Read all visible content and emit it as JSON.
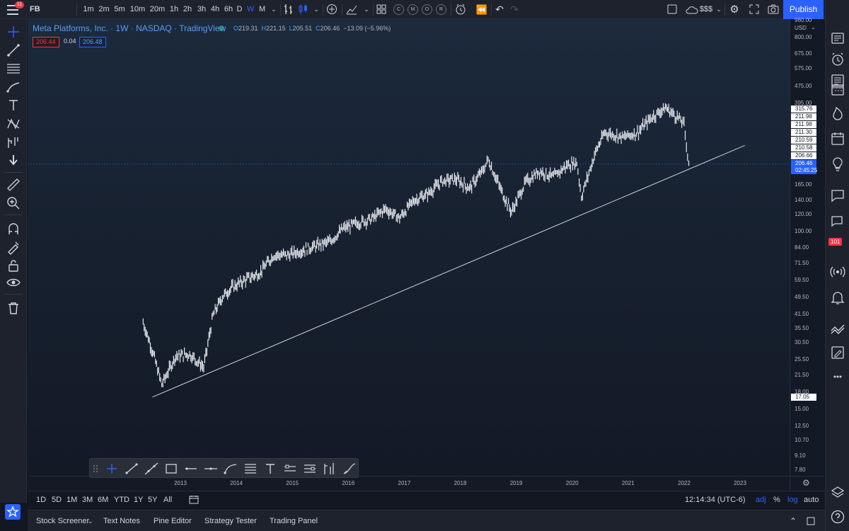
{
  "topbar": {
    "symbol": "FB",
    "notification_count": "11",
    "intervals": [
      "1m",
      "2m",
      "5m",
      "10m",
      "20m",
      "1h",
      "2h",
      "3h",
      "4h",
      "6h",
      "D",
      "W",
      "M"
    ],
    "active_interval": "W",
    "compare_label": "$$$",
    "publish_label": "Publish",
    "multi_chart_circles": [
      "C",
      "M",
      "O",
      "R"
    ]
  },
  "legend": {
    "title": "Meta Platforms, Inc.",
    "interval": "1W",
    "exchange": "NASDAQ",
    "source": "TradingView",
    "open_label": "O",
    "open": "219.31",
    "high_label": "H",
    "high": "221.15",
    "low_label": "L",
    "low": "205.51",
    "close_label": "C",
    "close": "206.46",
    "change": "−13.09 (−5.96%)",
    "bid": "206.44",
    "spread": "0.04",
    "ask": "206.48"
  },
  "price_scale": {
    "currency": "USD",
    "labels": [
      "960.00",
      "800.00",
      "675.00",
      "575.00",
      "475.00",
      "395.00",
      "165.00",
      "140.00",
      "120.00",
      "100.00",
      "84.00",
      "71.50",
      "59.50",
      "49.50",
      "41.50",
      "35.50",
      "30.50",
      "25.50",
      "21.50",
      "18.00",
      "15.00",
      "12.50",
      "10.70",
      "9.10",
      "7.80"
    ],
    "markers": [
      "315.76",
      "211.98",
      "211.98",
      "211.30",
      "210.59",
      "210.58",
      "206.66"
    ],
    "last_price": "206.46",
    "countdown": "02:45:25",
    "trendline_start_price": "17.05"
  },
  "time_scale": {
    "labels": [
      "2013",
      "2014",
      "2015",
      "2016",
      "2017",
      "2018",
      "2019",
      "2020",
      "2021",
      "2022",
      "2023"
    ]
  },
  "range_bar": {
    "ranges": [
      "1D",
      "5D",
      "1M",
      "3M",
      "6M",
      "YTD",
      "1Y",
      "5Y",
      "All"
    ],
    "clock": "12:14:34 (UTC-6)",
    "adj": "adj",
    "percent": "%",
    "log": "log",
    "auto": "auto"
  },
  "bottom_panel": {
    "tabs": [
      "Stock Screener",
      "Text Notes",
      "Pine Editor",
      "Strategy Tester",
      "Trading Panel"
    ]
  },
  "right_sidebar": {
    "alerts_badge": "101"
  },
  "chart_data": {
    "type": "line",
    "scale": "log",
    "series": [
      {
        "x": [
          "2012-05",
          "2012-07",
          "2012-09",
          "2012-12",
          "2013-03",
          "2013-06",
          "2013-08",
          "2013-10",
          "2013-12",
          "2014-03",
          "2014-06",
          "2014-09",
          "2014-12",
          "2015-03",
          "2015-06",
          "2015-09",
          "2015-12",
          "2016-03",
          "2016-06",
          "2016-09",
          "2016-12",
          "2017-03",
          "2017-06",
          "2017-09",
          "2017-12",
          "2018-03",
          "2018-06",
          "2018-07",
          "2018-10",
          "2018-12",
          "2019-03",
          "2019-06",
          "2019-09",
          "2019-12",
          "2020-02",
          "2020-03",
          "2020-06",
          "2020-08",
          "2020-12",
          "2021-03",
          "2021-06",
          "2021-09",
          "2021-12",
          "2022-01",
          "2022-02"
        ],
        "y": [
          38.0,
          28.0,
          19.5,
          26.5,
          27.0,
          23.5,
          41.0,
          50.0,
          55.0,
          60.0,
          64.5,
          78.0,
          78.0,
          82.0,
          86.0,
          90.0,
          104.0,
          110.0,
          115.0,
          128.0,
          116.0,
          140.0,
          150.0,
          172.0,
          176.0,
          160.0,
          195.0,
          217.0,
          152.0,
          124.0,
          170.0,
          192.0,
          180.0,
          205.0,
          210.0,
          146.0,
          235.0,
          290.0,
          275.0,
          290.0,
          340.0,
          378.0,
          335.0,
          316.0,
          206.46
        ]
      }
    ],
    "trendline": {
      "x": [
        "2012-07",
        "2023-02"
      ],
      "y": [
        17.05,
        252.0
      ]
    },
    "ylim": [
      7.8,
      960.0
    ],
    "xlim": [
      "2012-01",
      "2023-08"
    ],
    "grid": false
  }
}
